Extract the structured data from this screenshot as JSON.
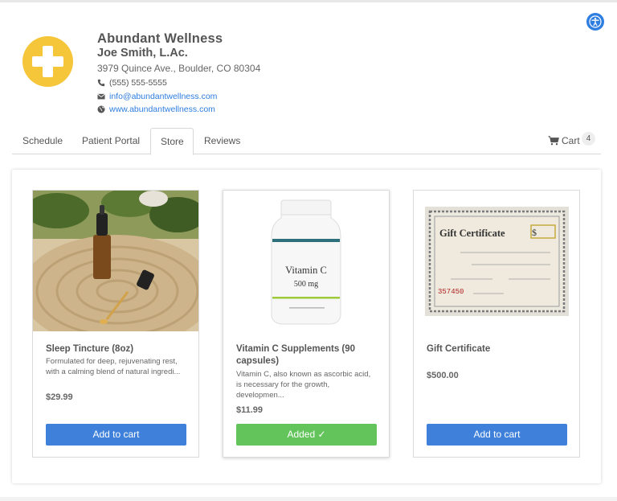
{
  "colors": {
    "accent": "#3e80da",
    "success": "#62c45a",
    "logo": "#f5c63a",
    "link": "#2e7de1"
  },
  "accessibility": {
    "icon": "accessibility-icon"
  },
  "business": {
    "name": "Abundant Wellness",
    "provider": "Joe Smith, L.Ac.",
    "address": "3979 Quince Ave., Boulder, CO  80304",
    "phone": "(555) 555-5555",
    "email": "info@abundantwellness.com",
    "website": "www.abundantwellness.com"
  },
  "tabs": [
    {
      "label": "Schedule"
    },
    {
      "label": "Patient Portal"
    },
    {
      "label": "Store",
      "active": true
    },
    {
      "label": "Reviews"
    }
  ],
  "cart": {
    "label": "Cart",
    "count": "4"
  },
  "products": [
    {
      "title": "Sleep Tincture (8oz)",
      "description": "Formulated for deep, rejuvenating rest, with a calming blend of natural ingredi...",
      "price": "$29.99",
      "button": "Add to cart"
    },
    {
      "title": "Vitamin C Supplements (90 capsules)",
      "description": "Vitamin C, also known as ascorbic acid, is necessary for the growth, developmen...",
      "price": "$11.99",
      "button": "Added ✓",
      "image_label_name": "Vitamin C",
      "image_label_dose": "500 mg"
    },
    {
      "title": "Gift Certificate",
      "description": "",
      "price": "$500.00",
      "button": "Add to cart",
      "image_heading": "Gift Certificate",
      "image_serial": "357450"
    }
  ]
}
